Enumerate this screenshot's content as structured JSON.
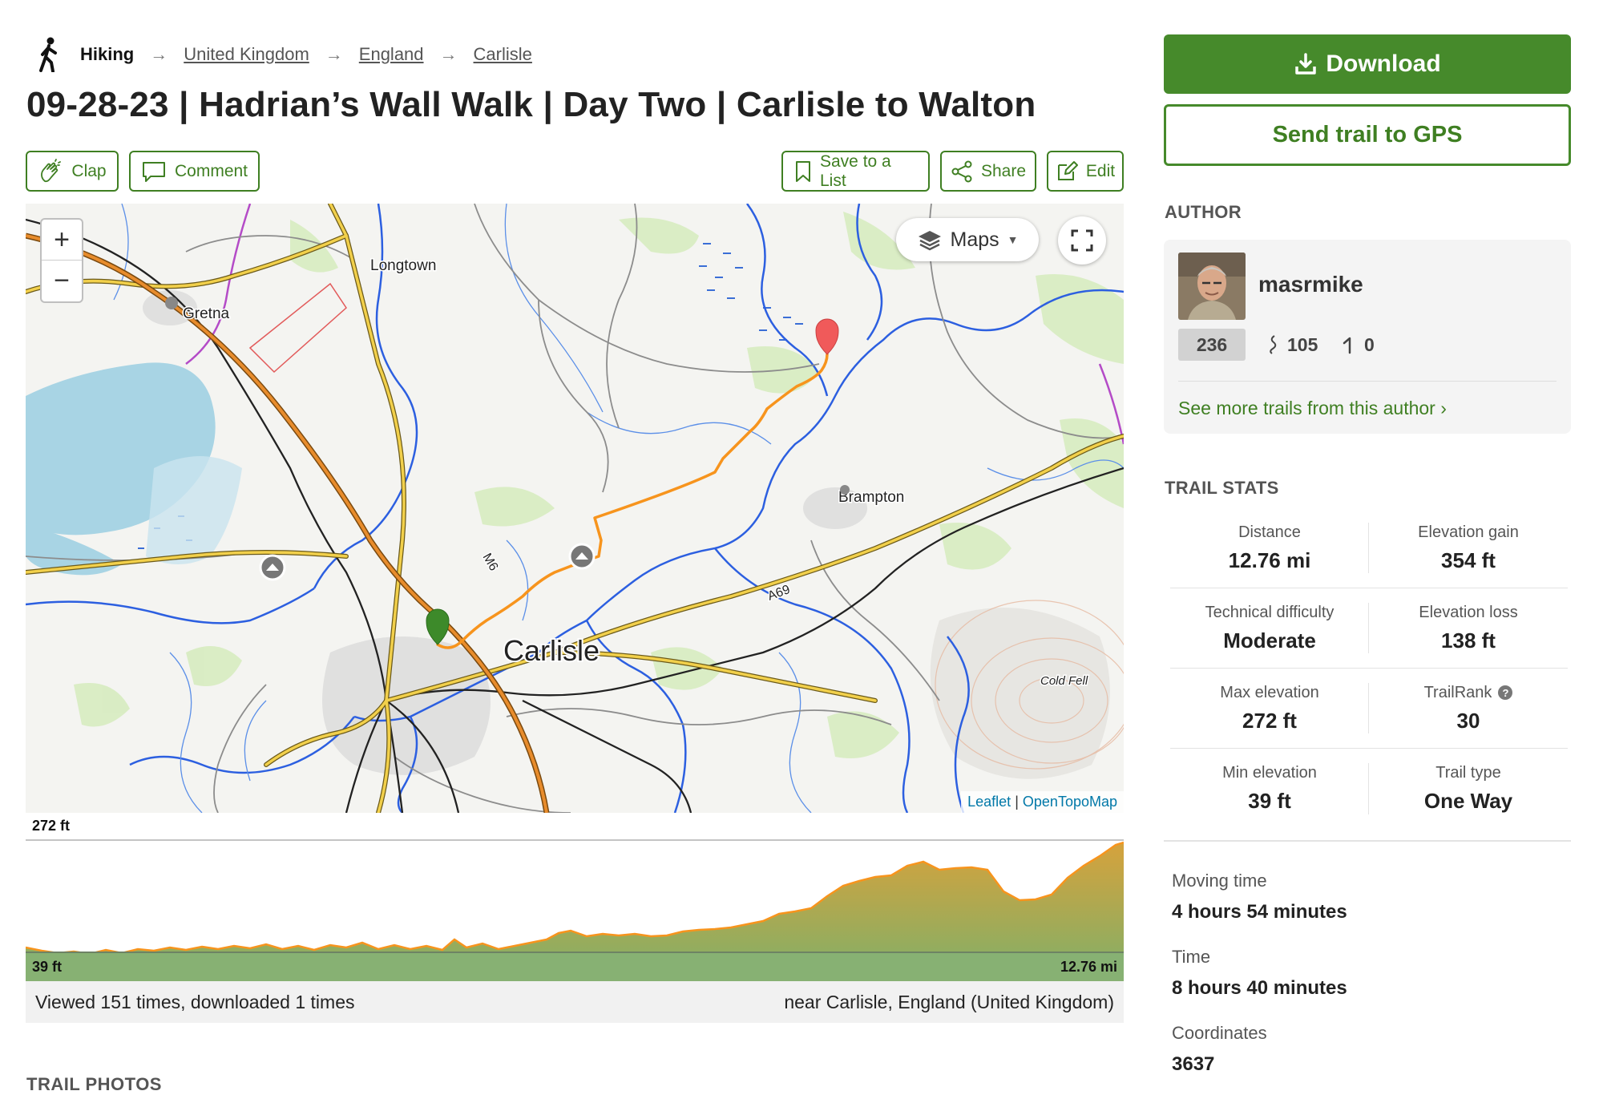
{
  "breadcrumb": {
    "activity": "Hiking",
    "items": [
      "United Kingdom",
      "England",
      "Carlisle"
    ]
  },
  "page_title": "09-28-23 | Hadrian’s Wall Walk | Day Two | Carlisle to Walton",
  "actions": {
    "clap": "Clap",
    "comment": "Comment",
    "save": "Save to a List",
    "share": "Share",
    "edit": "Edit"
  },
  "map": {
    "layers_label": "Maps",
    "zoom_in": "+",
    "zoom_out": "−",
    "places": [
      "Longtown",
      "Gretna",
      "Brampton",
      "Carlisle",
      "Cold Fell"
    ],
    "road_labels": [
      "M6",
      "A69"
    ],
    "attribution": {
      "leaflet": "Leaflet",
      "sep": "|",
      "tiles": "OpenTopoMap"
    }
  },
  "elevation": {
    "max_label": "272 ft",
    "min_label": "39 ft",
    "distance_label": "12.76 mi"
  },
  "info": {
    "views": "Viewed 151 times, downloaded 1 times",
    "location": "near Carlisle, England (United Kingdom)"
  },
  "sidebar": {
    "download": "Download",
    "send_gps": "Send trail to GPS",
    "author_heading": "AUTHOR",
    "author": {
      "name": "masrmike",
      "rank": "236",
      "trails": "105",
      "edits": "0",
      "more_link": "See more trails from this author ›"
    },
    "stats_heading": "TRAIL STATS",
    "stats": [
      {
        "label": "Distance",
        "value": "12.76 mi"
      },
      {
        "label": "Elevation gain",
        "value": "354 ft"
      },
      {
        "label": "Technical difficulty",
        "value": "Moderate"
      },
      {
        "label": "Elevation loss",
        "value": "138 ft"
      },
      {
        "label": "Max elevation",
        "value": "272 ft"
      },
      {
        "label": "TrailRank",
        "value": "30"
      },
      {
        "label": "Min elevation",
        "value": "39 ft"
      },
      {
        "label": "Trail type",
        "value": "One Way"
      }
    ],
    "extra": [
      {
        "label": "Moving time",
        "value": "4 hours 54 minutes"
      },
      {
        "label": "Time",
        "value": "8 hours 40 minutes"
      },
      {
        "label": "Coordinates",
        "value": "3637"
      }
    ]
  },
  "photos_heading": "TRAIL PHOTOS",
  "colors": {
    "brand_green": "#468a2b",
    "route_orange": "#f7941d",
    "start_marker": "#3d8a2a",
    "end_marker": "#f05a5a",
    "water": "#9fd3e6",
    "link_blue": "#0078a8"
  }
}
